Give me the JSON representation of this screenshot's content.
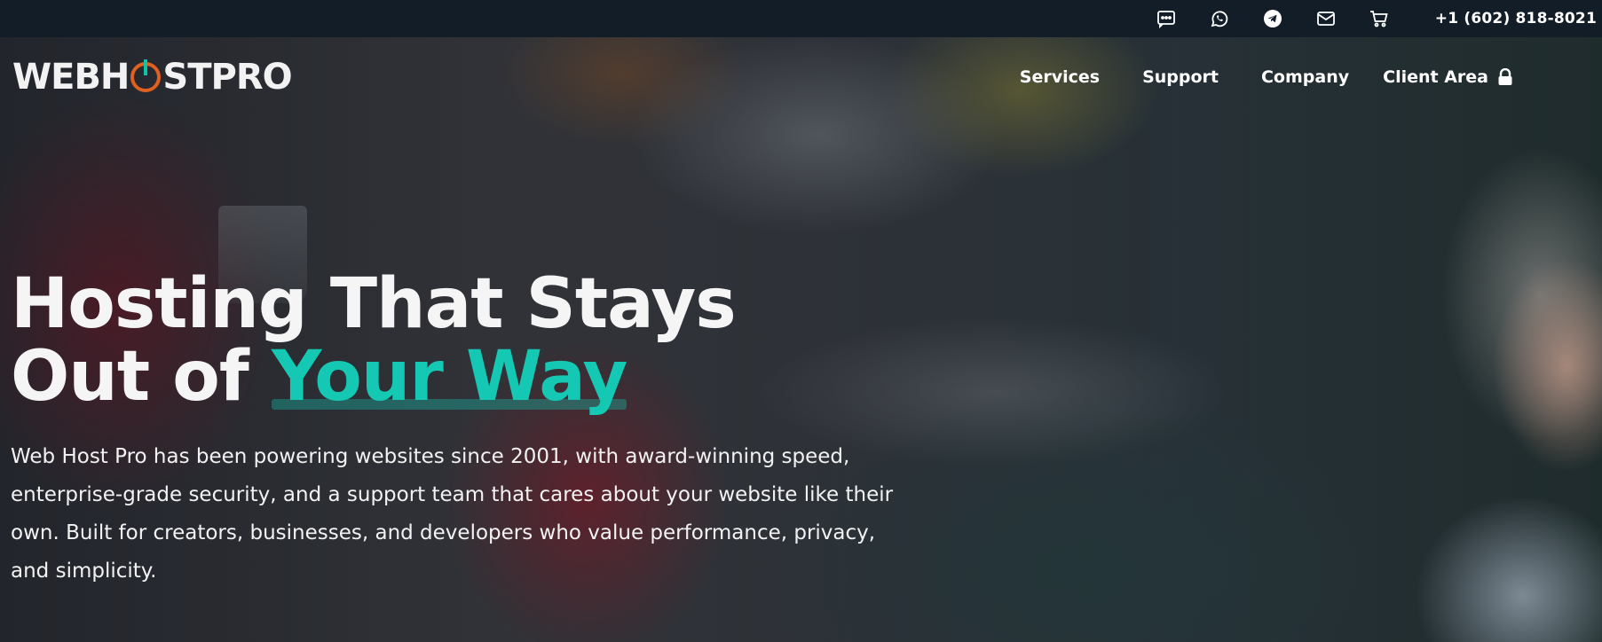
{
  "topbar": {
    "icons": [
      "chat-icon",
      "whatsapp-icon",
      "telegram-icon",
      "mail-icon",
      "cart-icon"
    ],
    "phone": "+1 (602) 818-8021"
  },
  "brand": {
    "logo_left": "WEBH",
    "logo_right": "STPRO",
    "accent_orange": "#e0601f",
    "accent_teal": "#10c3a8"
  },
  "nav": {
    "items": [
      "Services",
      "Support",
      "Company"
    ],
    "client_area": "Client Area"
  },
  "hero": {
    "headline_line1": "Hosting That Stays",
    "headline_line2_prefix": "Out of ",
    "headline_line2_accent": "Your Way",
    "description": "Web Host Pro has been powering websites since 2001, with award-winning speed, enterprise-grade security, and a support team that cares about your website like their own. Built for creators, businesses, and developers who value performance, privacy, and simplicity."
  }
}
